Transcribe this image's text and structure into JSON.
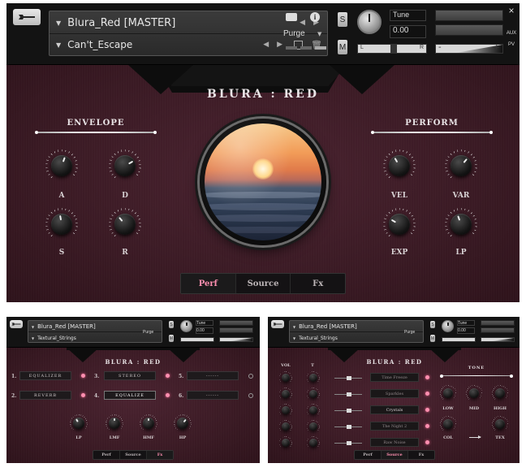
{
  "main": {
    "header": {
      "instrument_name": "Blura_Red [MASTER]",
      "preset_name": "Can't_Escape",
      "purge_label": "Purge",
      "s_label": "S",
      "m_label": "M",
      "tune_label": "Tune",
      "tune_value": "0.00",
      "pan_left": "L",
      "pan_right": "R",
      "vol_minus": "-",
      "vol_plus": "+",
      "aux_label": "AUX",
      "pv_label": "PV",
      "close_label": "×"
    },
    "title": "BLURA : RED",
    "envelope": {
      "title": "ENVELOPE",
      "knobs": [
        {
          "label": "A"
        },
        {
          "label": "D"
        },
        {
          "label": "S"
        },
        {
          "label": "R"
        }
      ]
    },
    "perform": {
      "title": "PERFORM",
      "knobs": [
        {
          "label": "VEL"
        },
        {
          "label": "VAR"
        },
        {
          "label": "EXP"
        },
        {
          "label": "LP"
        }
      ]
    },
    "tabs": [
      {
        "label": "Perf",
        "active": true
      },
      {
        "label": "Source",
        "active": false
      },
      {
        "label": "Fx",
        "active": false
      }
    ]
  },
  "fx_view": {
    "header": {
      "instrument_name": "Blura_Red [MASTER]",
      "preset_name": "Textural_Strings",
      "purge_label": "Purge",
      "tune_label": "Tune",
      "tune_value": "0.00"
    },
    "title": "BLURA : RED",
    "slots": [
      {
        "num": "1.",
        "name": "EQUALIZER"
      },
      {
        "num": "2.",
        "name": "REVERB"
      },
      {
        "num": "3.",
        "name": "STEREO"
      },
      {
        "num": "4.",
        "name": "EQUALIZE"
      },
      {
        "num": "5.",
        "name": "------"
      },
      {
        "num": "6.",
        "name": "------"
      }
    ],
    "knobs": [
      {
        "label": "LP"
      },
      {
        "label": "LMF"
      },
      {
        "label": "HMF"
      },
      {
        "label": "HP"
      }
    ],
    "tabs": [
      {
        "label": "Perf"
      },
      {
        "label": "Source"
      },
      {
        "label": "Fx"
      }
    ]
  },
  "source_view": {
    "header": {
      "instrument_name": "Blura_Red [MASTER]",
      "preset_name": "Textural_Strings",
      "purge_label": "Purge",
      "tune_label": "Tune",
      "tune_value": "0.00"
    },
    "title": "BLURA : RED",
    "col_vol": "VOL",
    "col_tune": "T",
    "samples": [
      {
        "name": "Time Freeze"
      },
      {
        "name": "Sparkles"
      },
      {
        "name": "Crystals"
      },
      {
        "name": "The Night 2"
      },
      {
        "name": "Raw Noise"
      }
    ],
    "tone": {
      "title": "TONE",
      "knobs": [
        {
          "label": "LOW"
        },
        {
          "label": "MID"
        },
        {
          "label": "HIGH"
        },
        {
          "label": "COL"
        },
        {
          "label": "TEX"
        }
      ]
    },
    "tabs": [
      {
        "label": "Perf"
      },
      {
        "label": "Source"
      },
      {
        "label": "Fx"
      }
    ]
  },
  "colors": {
    "accent_pink": "#ff8fb0",
    "body_red": "#3a1a24",
    "header_black": "#131313"
  }
}
